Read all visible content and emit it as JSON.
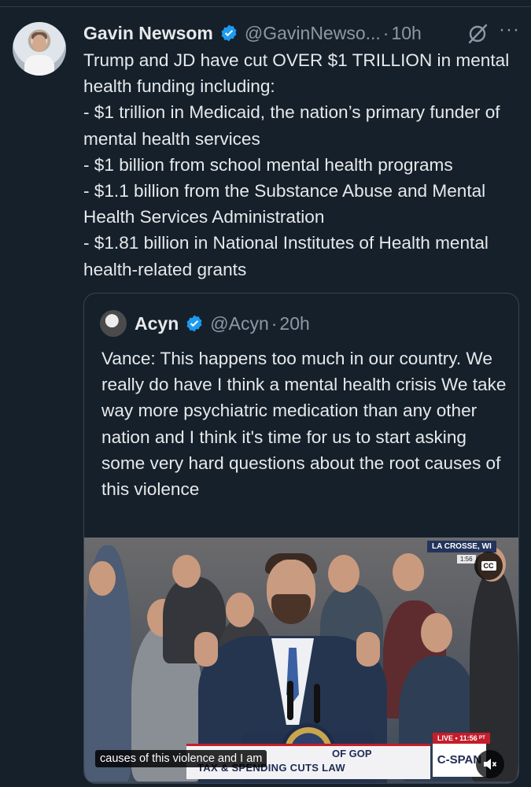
{
  "tweet": {
    "author_name": "Gavin Newsom",
    "handle": "@GavinNewso...",
    "separator": "·",
    "time": "10h",
    "more_label": "···",
    "text": "Trump and JD have cut OVER $1 TRILLION in mental health funding including:\n- $1 trillion in Medicaid, the nation’s primary funder of mental health services\n- $1 billion from school mental health programs\n- $1.1 billion from the Substance Abuse and Mental Health Services Administration\n- $1.81 billion in National Institutes of Health mental health-related grants"
  },
  "quote": {
    "author_name": "Acyn",
    "handle": "@Acyn",
    "separator": "·",
    "time": "20h",
    "text": "Vance: This happens too much in our country. We really do have I think a mental health crisis We take way more psychiatric medication than any other nation and I think it's time for us to start asking some very hard questions about the root causes of this violence"
  },
  "video": {
    "location": "LA CROSSE, WI",
    "location_time": "1:56",
    "cc_label": "CC",
    "caption": "causes of this violence and I am",
    "chyron_line1": "OF GOP",
    "chyron_line2": "TAX & SPENDING CUTS LAW",
    "live_label": "LIVE • 11:56 ᴾᵀ",
    "network": "C-SPAN"
  },
  "colors": {
    "background": "#15202b",
    "verified": "#1d9bf0",
    "muted_text": "#8b98a5",
    "border": "#38444d"
  }
}
